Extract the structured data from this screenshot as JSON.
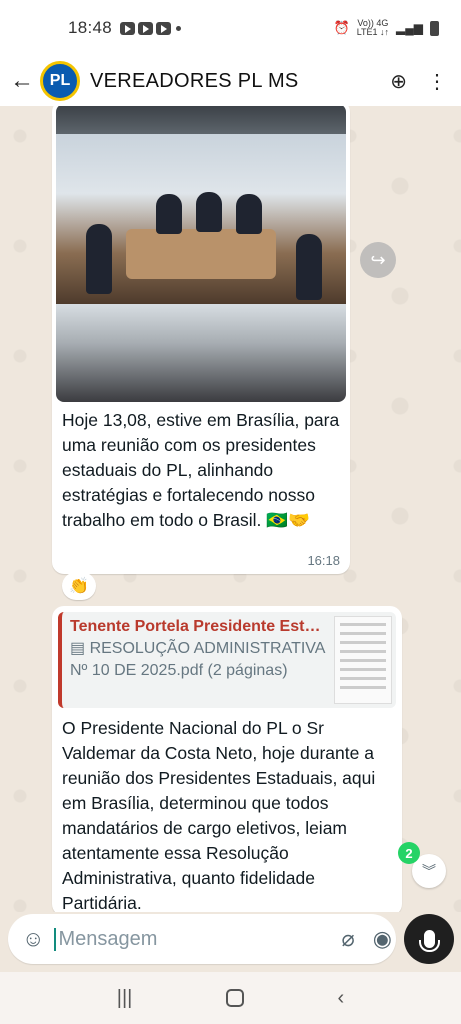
{
  "status_bar": {
    "time": "18:48",
    "network_line1": "Vo)) 4G",
    "network_line2": "LTE1 ↓↑"
  },
  "header": {
    "title": "VEREADORES PL MS",
    "avatar_text": "PL",
    "back_icon": "←",
    "call_icon": "⊕",
    "menu_icon": "⋮"
  },
  "messages": [
    {
      "type": "image",
      "text": "Hoje 13,08, estive em Brasília, para uma reunião com os presidentes estaduais do PL, alinhando estratégias e fortalecendo nosso trabalho em todo o Brasil. 🇧🇷🤝",
      "time": "16:18",
      "reaction": "👏"
    },
    {
      "type": "document_reply",
      "quote_author": "Tenente Portela Presidente Esta...",
      "quote_doc": "▤ RESOLUÇÃO ADMINISTRATIVA Nº 10 DE 2025.pdf (2 páginas)",
      "text": "O Presidente Nacional do PL o Sr Valdemar da Costa Neto, hoje durante a reunião dos Presidentes Estaduais, aqui em Brasília, determinou que todos mandatários de cargo eletivos, leiam atentamente essa Resolução Administrativa, quanto fidelidade Partidária."
    }
  ],
  "unread_count": "2",
  "scroll_icon": "︾",
  "forward_icon": "↪",
  "composer": {
    "placeholder": "Mensagem",
    "emoji_icon": "☺",
    "attach_icon": "⌀",
    "camera_icon": "◉"
  },
  "nav": {
    "recents": "|||",
    "back": "‹"
  },
  "colors": {
    "chat_bg": "#efe7dd",
    "accent": "#25d366",
    "quote_bar": "#c0392b"
  }
}
